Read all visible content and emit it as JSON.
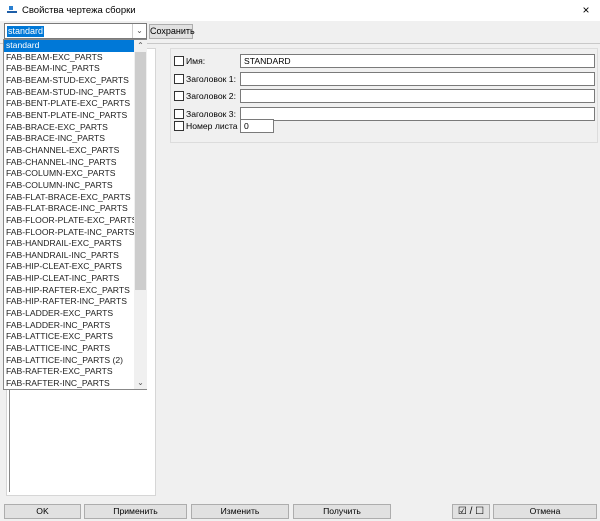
{
  "window": {
    "title": "Свойства чертежа сборки",
    "close_icon": "×"
  },
  "toolbar": {
    "preset_value": "standard",
    "save_label": "Сохранить"
  },
  "dropdown": {
    "items": [
      "standard",
      "FAB-BEAM-EXC_PARTS",
      "FAB-BEAM-INC_PARTS",
      "FAB-BEAM-STUD-EXC_PARTS",
      "FAB-BEAM-STUD-INC_PARTS",
      "FAB-BENT-PLATE-EXC_PARTS",
      "FAB-BENT-PLATE-INC_PARTS",
      "FAB-BRACE-EXC_PARTS",
      "FAB-BRACE-INC_PARTS",
      "FAB-CHANNEL-EXC_PARTS",
      "FAB-CHANNEL-INC_PARTS",
      "FAB-COLUMN-EXC_PARTS",
      "FAB-COLUMN-INC_PARTS",
      "FAB-FLAT-BRACE-EXC_PARTS",
      "FAB-FLAT-BRACE-INC_PARTS",
      "FAB-FLOOR-PLATE-EXC_PARTS",
      "FAB-FLOOR-PLATE-INC_PARTS",
      "FAB-HANDRAIL-EXC_PARTS",
      "FAB-HANDRAIL-INC_PARTS",
      "FAB-HIP-CLEAT-EXC_PARTS",
      "FAB-HIP-CLEAT-INC_PARTS",
      "FAB-HIP-RAFTER-EXC_PARTS",
      "FAB-HIP-RAFTER-INC_PARTS",
      "FAB-LADDER-EXC_PARTS",
      "FAB-LADDER-INC_PARTS",
      "FAB-LATTICE-EXC_PARTS",
      "FAB-LATTICE-INC_PARTS",
      "FAB-LATTICE-INC_PARTS (2)",
      "FAB-RAFTER-EXC_PARTS",
      "FAB-RAFTER-INC_PARTS"
    ],
    "selected_index": 0
  },
  "fields": [
    {
      "label": "Имя:",
      "value": "STANDARD",
      "checked": false
    },
    {
      "label": "Заголовок 1:",
      "value": "",
      "checked": false
    },
    {
      "label": "Заголовок 2:",
      "value": "",
      "checked": false
    },
    {
      "label": "Заголовок 3:",
      "value": "",
      "checked": false
    },
    {
      "label": "Номер листа",
      "value": "0",
      "checked": false
    }
  ],
  "buttons": {
    "ok": "OK",
    "apply": "Применить",
    "modify": "Изменить",
    "get": "Получить",
    "toggle": "☑ / ☐",
    "cancel": "Отмена"
  }
}
